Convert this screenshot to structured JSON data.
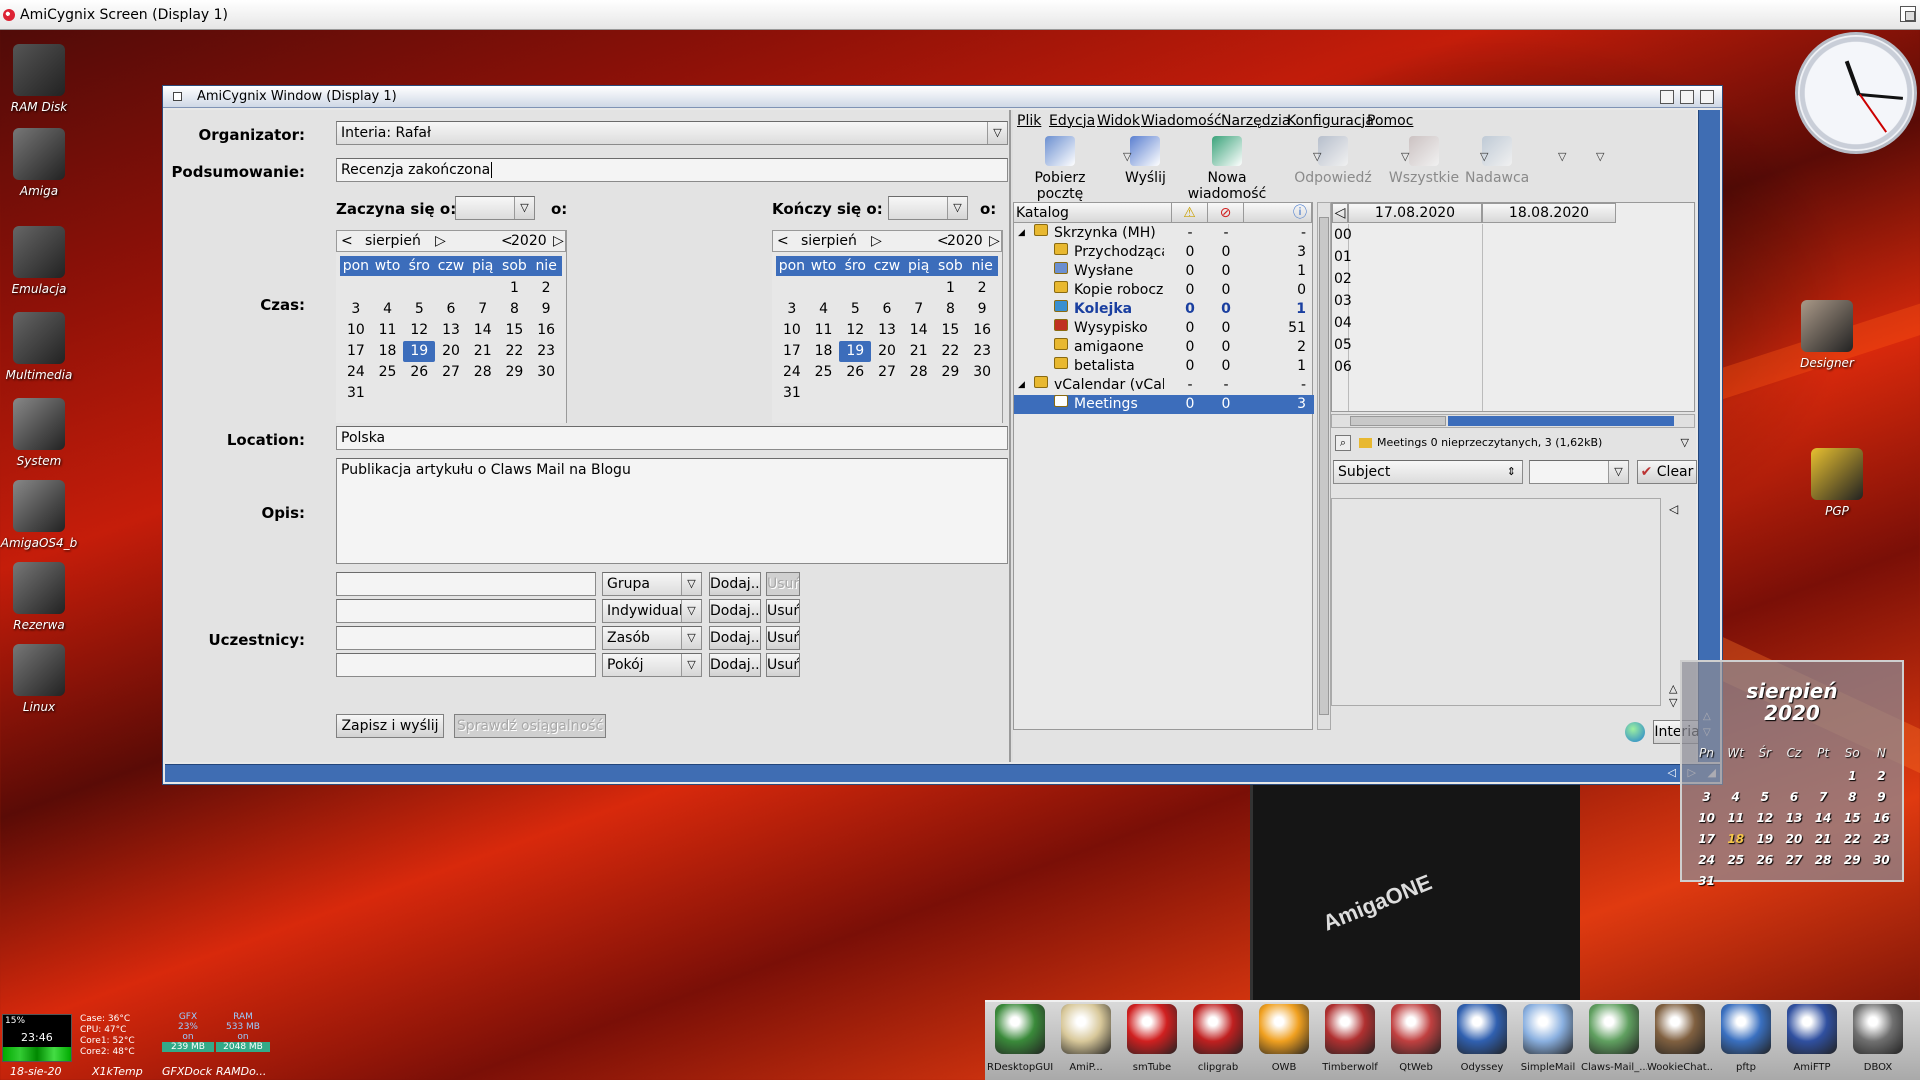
{
  "screen": {
    "title": "AmiCygnix Screen (Display 1)"
  },
  "desktop_icons": [
    {
      "label": "RAM Disk",
      "icon": "ram-disk-icon"
    },
    {
      "label": "Amiga",
      "icon": "amiga-drive-icon"
    },
    {
      "label": "Emulacja",
      "icon": "gamepad-drive-icon"
    },
    {
      "label": "Multimedia",
      "icon": "film-reel-drive-icon"
    },
    {
      "label": "System",
      "icon": "boing-ball-drive-icon"
    },
    {
      "label": "AmigaOS4_b",
      "icon": "boing-ball-drive-icon"
    },
    {
      "label": "Rezerwa",
      "icon": "tools-drive-icon"
    },
    {
      "label": "Linux",
      "icon": "tux-drive-icon"
    },
    {
      "label": "Designer",
      "icon": "hollywood-clapper-icon"
    },
    {
      "label": "PGP",
      "icon": "padlock-icon"
    }
  ],
  "window": {
    "title": "AmiCygnix Window (Display 1)"
  },
  "form": {
    "organizer_label": "Organizator:",
    "organizer_value": "Interia: Rafał",
    "summary_label": "Podsumowanie:",
    "summary_value": "Recenzja zakończona",
    "time_label": "Czas:",
    "starts_label": "Zaczyna się o:",
    "ends_label": "Kończy się o:",
    "at_label": "o:",
    "location_label": "Location:",
    "location_value": "Polska",
    "description_label": "Opis:",
    "description_value": "Publikacja artykułu o Claws Mail na Blogu",
    "participants_label": "Uczestnicy:",
    "participant_rows": [
      {
        "type": "Grupa",
        "add": "Dodaj...",
        "remove": "Usuń",
        "remove_disabled": true
      },
      {
        "type": "Indywidualny",
        "add": "Dodaj...",
        "remove": "Usuń",
        "remove_disabled": false
      },
      {
        "type": "Zasób",
        "add": "Dodaj...",
        "remove": "Usuń",
        "remove_disabled": false
      },
      {
        "type": "Pokój",
        "add": "Dodaj...",
        "remove": "Usuń",
        "remove_disabled": false
      }
    ],
    "save_button": "Zapisz i wyślij",
    "check_button": "Sprawdź osiągalność"
  },
  "calendars": [
    {
      "month": "sierpień",
      "year": "2020",
      "weekdays": [
        "pon",
        "wto",
        "śro",
        "czw",
        "pią",
        "sob",
        "nie"
      ],
      "leading_blanks": 5,
      "days": 31,
      "selected": 19
    },
    {
      "month": "sierpień",
      "year": "2020",
      "weekdays": [
        "pon",
        "wto",
        "śro",
        "czw",
        "pią",
        "sob",
        "nie"
      ],
      "leading_blanks": 5,
      "days": 31,
      "selected": 19
    }
  ],
  "mail": {
    "menu": [
      "Plik",
      "Edycja",
      "Widok",
      "Wiadomość",
      "Narzędzia",
      "Konfiguracja",
      "Pomoc"
    ],
    "toolbar": [
      {
        "label": "Pobierz pocztę",
        "icon": "fetch-mail-icon",
        "enabled": true
      },
      {
        "label": "Wyślij",
        "icon": "send-icon",
        "enabled": true
      },
      {
        "label": "Nowa wiadomość",
        "icon": "compose-icon",
        "enabled": true
      },
      {
        "label": "Odpowiedź",
        "icon": "reply-icon",
        "enabled": false
      },
      {
        "label": "Wszystkie",
        "icon": "reply-all-icon",
        "enabled": false
      },
      {
        "label": "Nadawca",
        "icon": "reply-sender-icon",
        "enabled": false
      }
    ],
    "folder_header": {
      "name": "Katalog"
    },
    "folders": [
      {
        "name": "Skrzynka (MH)",
        "new": "-",
        "unread": "-",
        "total": "-",
        "level": 0,
        "expander": "◢",
        "icon_color": "#e8b830",
        "bold": false
      },
      {
        "name": "Przychodząca",
        "new": "0",
        "unread": "0",
        "total": "3",
        "level": 1,
        "icon_color": "#e8b830",
        "bold": false
      },
      {
        "name": "Wysłane",
        "new": "0",
        "unread": "0",
        "total": "1",
        "level": 1,
        "icon_color": "#6b8fd0",
        "bold": false
      },
      {
        "name": "Kopie robocze",
        "new": "0",
        "unread": "0",
        "total": "0",
        "level": 1,
        "icon_color": "#e8b830",
        "bold": false
      },
      {
        "name": "Kolejka",
        "new": "0",
        "unread": "0",
        "total": "1",
        "level": 1,
        "icon_color": "#3a8fd0",
        "bold": true
      },
      {
        "name": "Wysypisko",
        "new": "0",
        "unread": "0",
        "total": "51",
        "level": 1,
        "icon_color": "#c03020",
        "bold": false
      },
      {
        "name": "amigaone",
        "new": "0",
        "unread": "0",
        "total": "2",
        "level": 1,
        "icon_color": "#e8b830",
        "bold": false
      },
      {
        "name": "betalista",
        "new": "0",
        "unread": "0",
        "total": "1",
        "level": 1,
        "icon_color": "#e8b830",
        "bold": false
      },
      {
        "name": "vCalendar (vCale",
        "new": "-",
        "unread": "-",
        "total": "-",
        "level": 0,
        "expander": "◢",
        "icon_color": "#e8b830",
        "bold": false
      },
      {
        "name": "Meetings",
        "new": "0",
        "unread": "0",
        "total": "3",
        "level": 1,
        "icon_color": "#ffffff",
        "bold": false,
        "selected": true
      }
    ],
    "schedule": {
      "dates": [
        "17.08.2020",
        "18.08.2020"
      ],
      "hours": [
        "00",
        "01",
        "02",
        "03",
        "04",
        "05",
        "06"
      ]
    },
    "status_text": "Meetings 0 nieprzeczytanych, 3 (1,62kB)",
    "search_field": "Subject",
    "clear_button": "Clear",
    "account_button": "Interia"
  },
  "desk_calendar": {
    "month": "sierpień",
    "year": "2020",
    "weekdays": [
      "Pn",
      "Wt",
      "Śr",
      "Cz",
      "Pt",
      "So",
      "N"
    ],
    "leading_blanks": 5,
    "days": 31,
    "today": 18
  },
  "dock": [
    {
      "label": "RDesktopGUI",
      "icon": "rdesktop-icon"
    },
    {
      "label": "AmiP...",
      "icon": "amipdf-icon"
    },
    {
      "label": "smTube",
      "icon": "youtube-icon"
    },
    {
      "label": "clipgrab",
      "icon": "youtube-icon"
    },
    {
      "label": "OWB",
      "icon": "owb-icon"
    },
    {
      "label": "Timberwolf",
      "icon": "timberwolf-icon"
    },
    {
      "label": "QtWeb",
      "icon": "qtweb-icon"
    },
    {
      "label": "Odyssey",
      "icon": "odyssey-icon"
    },
    {
      "label": "SimpleMail",
      "icon": "simplemail-icon"
    },
    {
      "label": "Claws-Mail_...",
      "icon": "claws-mail-icon"
    },
    {
      "label": "WookieChat...",
      "icon": "wookiechat-icon"
    },
    {
      "label": "pftp",
      "icon": "pftp-icon"
    },
    {
      "label": "AmiFTP",
      "icon": "amiftp-icon"
    },
    {
      "label": "DBOX",
      "icon": "dbox-icon"
    }
  ],
  "sysmon": {
    "cpu_percent": "15%",
    "time": "23:46",
    "date": "18-sie-20",
    "temps": [
      "Case: 36°C",
      "CPU: 47°C",
      "Core1: 52°C",
      "Core2: 48°C"
    ],
    "gfx_label": "GFX",
    "gfx_percent": "23%",
    "gfx_on": "on",
    "gfx_mem": "239 MB",
    "ram_label": "RAM",
    "ram_used": "533 MB",
    "ram_on": "on",
    "ram_total": "2048 MB",
    "labels": [
      "X1kTemp",
      "GFXDock",
      "RAMDo..."
    ]
  },
  "colors": {
    "accent": "#3c6dbb",
    "window_frame": "#3f6db3",
    "desktop_red": "#c51d0a"
  }
}
